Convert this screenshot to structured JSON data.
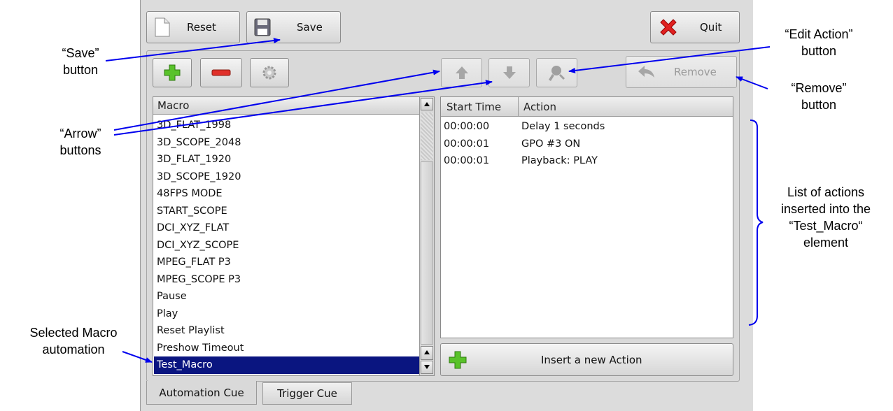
{
  "toolbar": {
    "reset_label": "Reset",
    "save_label": "Save",
    "quit_label": "Quit"
  },
  "action_toolbar": {
    "remove_label": "Remove"
  },
  "macro_list": {
    "header": "Macro",
    "items": [
      "3D_FLAT_1998",
      "3D_SCOPE_2048",
      "3D_FLAT_1920",
      "3D_SCOPE_1920",
      "48FPS MODE",
      "START_SCOPE",
      "DCI_XYZ_FLAT",
      "DCI_XYZ_SCOPE",
      "MPEG_FLAT P3",
      "MPEG_SCOPE P3",
      "Pause",
      "Play",
      "Reset Playlist",
      "Preshow Timeout",
      "Test_Macro"
    ],
    "selected": "Test_Macro"
  },
  "actions_table": {
    "columns": [
      "Start Time",
      "Action"
    ],
    "rows": [
      {
        "time": "00:00:00",
        "action": "Delay 1 seconds"
      },
      {
        "time": "00:00:01",
        "action": "GPO #3 ON"
      },
      {
        "time": "00:00:01",
        "action": "Playback: PLAY"
      }
    ]
  },
  "insert_action_label": "Insert a new Action",
  "tabs": [
    "Automation Cue",
    "Trigger Cue"
  ],
  "annotations": {
    "save": "“Save”\nbutton",
    "arrow": "“Arrow”\nbuttons",
    "selected": "Selected Macro\nautomation",
    "edit": "“Edit Action”\nbutton",
    "remove": "“Remove”\nbutton",
    "list": "List of actions\ninserted into the\n“Test_Macro“\nelement"
  },
  "colors": {
    "selection": "#0a1580",
    "annotation_arrow": "#0000ee"
  }
}
